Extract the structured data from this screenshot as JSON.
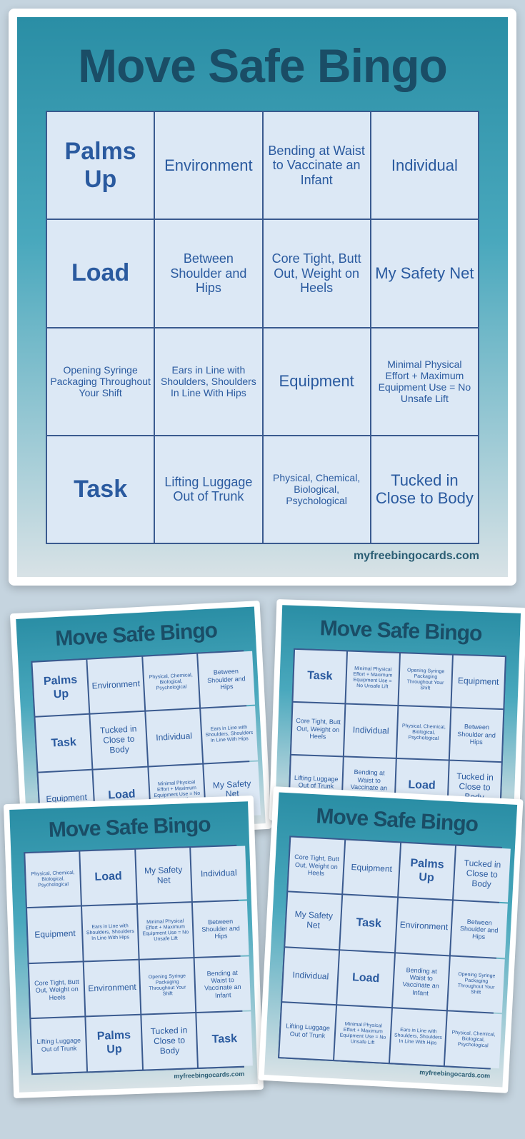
{
  "title": "Move Safe Bingo",
  "footer": "myfreebingocards.com",
  "squares": {
    "palms_up": "Palms Up",
    "environment": "Environment",
    "bending_infant": "Bending at Waist to Vaccinate an Infant",
    "individual": "Individual",
    "load": "Load",
    "shoulder_hips": "Between Shoulder and Hips",
    "core_tight": "Core Tight, Butt Out, Weight on Heels",
    "safety_net": "My Safety Net",
    "syringe": "Opening Syringe Packaging Throughout Your Shift",
    "ears_line": "Ears in Line with Shoulders, Shoulders In Line With Hips",
    "equipment": "Equipment",
    "minimal_effort": "Minimal Physical Effort + Maximum Equipment Use = No Unsafe Lift",
    "task": "Task",
    "luggage": "Lifting Luggage Out of Trunk",
    "pcbp": "Physical, Chemical, Biological, Psychological",
    "tucked": "Tucked in Close to Body"
  },
  "main_card": [
    [
      "palms_up",
      "environment",
      "bending_infant",
      "individual"
    ],
    [
      "load",
      "shoulder_hips",
      "core_tight",
      "safety_net"
    ],
    [
      "syringe",
      "ears_line",
      "equipment",
      "minimal_effort"
    ],
    [
      "task",
      "luggage",
      "pcbp",
      "tucked"
    ]
  ],
  "thumb1": [
    [
      "palms_up",
      "environment",
      "pcbp",
      "shoulder_hips"
    ],
    [
      "task",
      "tucked",
      "individual",
      "ears_line"
    ],
    [
      "equipment",
      "load",
      "minimal_effort",
      "safety_net"
    ]
  ],
  "thumb2": [
    [
      "task",
      "minimal_effort",
      "syringe",
      "equipment"
    ],
    [
      "core_tight",
      "individual",
      "pcbp",
      "shoulder_hips"
    ],
    [
      "luggage",
      "bending_infant",
      "load",
      "tucked"
    ]
  ],
  "thumb3": [
    [
      "pcbp",
      "load",
      "safety_net",
      "individual"
    ],
    [
      "equipment",
      "ears_line",
      "minimal_effort",
      "shoulder_hips"
    ],
    [
      "core_tight",
      "environment",
      "syringe",
      "bending_infant"
    ],
    [
      "luggage",
      "palms_up",
      "tucked",
      "task"
    ]
  ],
  "thumb4": [
    [
      "core_tight",
      "equipment",
      "palms_up",
      "tucked"
    ],
    [
      "safety_net",
      "task",
      "environment",
      "shoulder_hips"
    ],
    [
      "individual",
      "load",
      "bending_infant",
      "syringe"
    ],
    [
      "luggage",
      "minimal_effort",
      "ears_line",
      "pcbp"
    ]
  ],
  "size_map": {
    "palms_up": "big",
    "load": "big",
    "task": "big",
    "safety_net": "med",
    "environment": "med",
    "individual": "med",
    "equipment": "med",
    "tucked": "med",
    "shoulder_hips": "",
    "core_tight": "",
    "bending_infant": "",
    "luggage": "",
    "syringe": "tiny",
    "ears_line": "tiny",
    "minimal_effort": "tiny",
    "pcbp": "tiny"
  }
}
